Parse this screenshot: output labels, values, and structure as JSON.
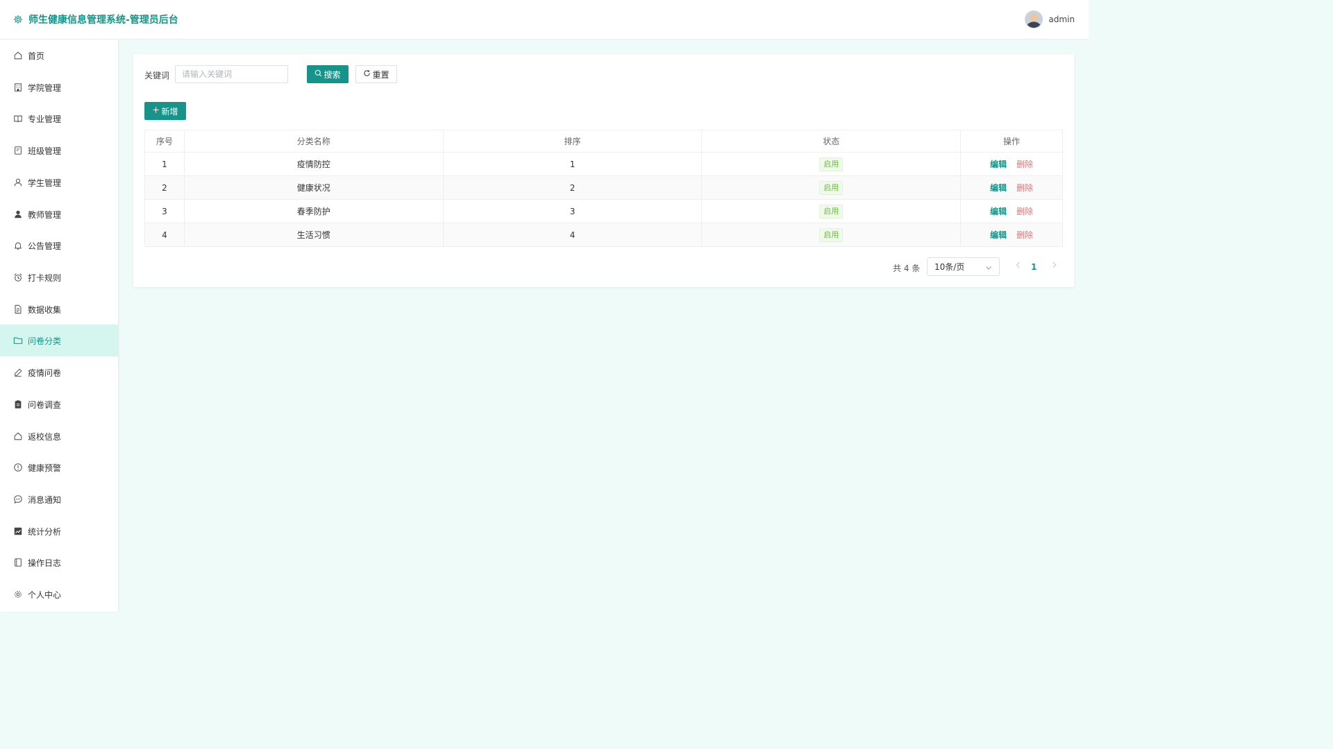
{
  "header": {
    "title": "师生健康信息管理系统-管理员后台",
    "username": "admin"
  },
  "sidebar": {
    "items": [
      {
        "label": "首页",
        "icon": "home-icon"
      },
      {
        "label": "学院管理",
        "icon": "building-icon"
      },
      {
        "label": "专业管理",
        "icon": "book-icon"
      },
      {
        "label": "班级管理",
        "icon": "notebook-icon"
      },
      {
        "label": "学生管理",
        "icon": "user-icon"
      },
      {
        "label": "教师管理",
        "icon": "user-filled-icon"
      },
      {
        "label": "公告管理",
        "icon": "bell-icon"
      },
      {
        "label": "打卡规则",
        "icon": "alarm-clock-icon"
      },
      {
        "label": "数据收集",
        "icon": "document-icon"
      },
      {
        "label": "问卷分类",
        "icon": "folder-icon"
      },
      {
        "label": "疫情问卷",
        "icon": "pen-icon"
      },
      {
        "label": "问卷调查",
        "icon": "clipboard-icon"
      },
      {
        "label": "返校信息",
        "icon": "house-icon"
      },
      {
        "label": "健康预警",
        "icon": "warning-icon"
      },
      {
        "label": "消息通知",
        "icon": "chat-icon"
      },
      {
        "label": "统计分析",
        "icon": "chart-icon"
      },
      {
        "label": "操作日志",
        "icon": "notebook-icon"
      },
      {
        "label": "个人中心",
        "icon": "gear-icon"
      }
    ],
    "active_index": 9
  },
  "search": {
    "label": "关键词",
    "placeholder": "请输入关键词",
    "value": "",
    "search_label": "搜索",
    "reset_label": "重置",
    "add_label": "新增"
  },
  "table": {
    "headers": [
      "序号",
      "分类名称",
      "排序",
      "状态",
      "操作"
    ],
    "rows": [
      {
        "index": "1",
        "name": "疫情防控",
        "sort": "1",
        "status": "启用"
      },
      {
        "index": "2",
        "name": "健康状况",
        "sort": "2",
        "status": "启用"
      },
      {
        "index": "3",
        "name": "春季防护",
        "sort": "3",
        "status": "启用"
      },
      {
        "index": "4",
        "name": "生活习惯",
        "sort": "4",
        "status": "启用"
      }
    ],
    "edit_label": "编辑",
    "delete_label": "删除"
  },
  "pagination": {
    "total_text": "共 4 条",
    "page_size": "10条/页",
    "current_page": "1"
  },
  "colors": {
    "primary": "#17948a",
    "danger": "#f56c6c",
    "success": "#67c23a",
    "background": "#effbf8",
    "active_nav_bg": "#d5f6ee"
  }
}
